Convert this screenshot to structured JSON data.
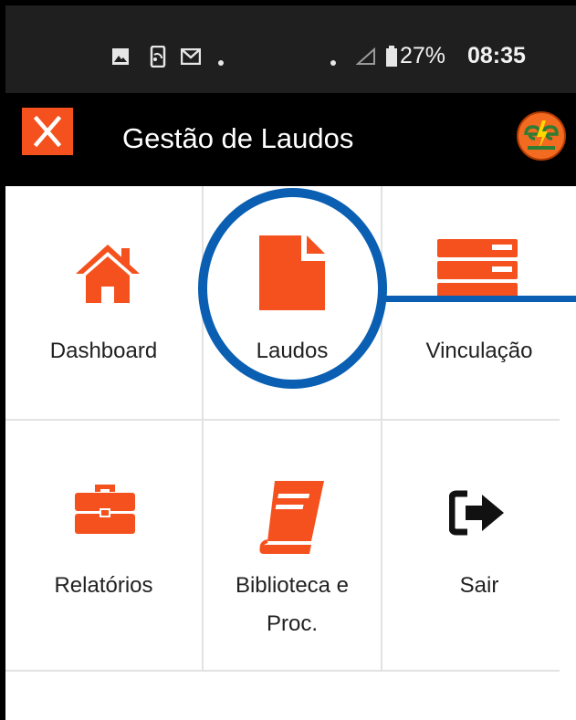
{
  "status_bar": {
    "battery": "27%",
    "time": "08:35",
    "icons": [
      "image-icon",
      "screencast-icon",
      "gmail-icon",
      "notification-dot-icon",
      "notification-dot-icon",
      "signal-icon",
      "battery-icon"
    ]
  },
  "toolbar": {
    "title": "Gestão de Laudos",
    "close_icon": "close-icon",
    "logo_icon": "company-logo-icon"
  },
  "menu": {
    "items": [
      {
        "label": "Dashboard",
        "icon": "home-icon"
      },
      {
        "label": "Laudos",
        "icon": "document-icon"
      },
      {
        "label": "Vinculação",
        "icon": "server-icon"
      },
      {
        "label": "Relatórios",
        "icon": "briefcase-icon"
      },
      {
        "label": "Biblioteca e",
        "label2": "Proc.",
        "icon": "book-icon"
      },
      {
        "label": "Sair",
        "icon": "sign-out-icon"
      }
    ]
  },
  "colors": {
    "accent": "#f4511e",
    "annotation": "#0a5fb2",
    "statusbar": "#1f1f1f",
    "toolbar": "#000000"
  }
}
